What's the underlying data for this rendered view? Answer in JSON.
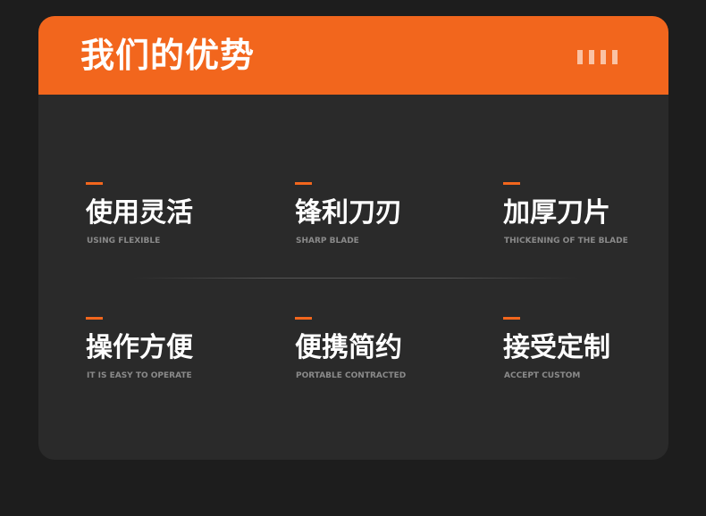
{
  "header": {
    "title": "我们的优势"
  },
  "colors": {
    "accent": "#f2661d",
    "card_background": "#2a2a2a",
    "page_background": "#1d1d1d"
  },
  "features": [
    {
      "title": "使用灵活",
      "subtitle": "USING FLEXIBLE"
    },
    {
      "title": "锋利刀刃",
      "subtitle": "SHARP BLADE"
    },
    {
      "title": "加厚刀片",
      "subtitle": "THICKENING OF THE BLADE"
    },
    {
      "title": "操作方便",
      "subtitle": "IT IS EASY TO OPERATE"
    },
    {
      "title": "便携简约",
      "subtitle": "PORTABLE CONTRACTED"
    },
    {
      "title": "接受定制",
      "subtitle": "ACCEPT CUSTOM"
    }
  ]
}
